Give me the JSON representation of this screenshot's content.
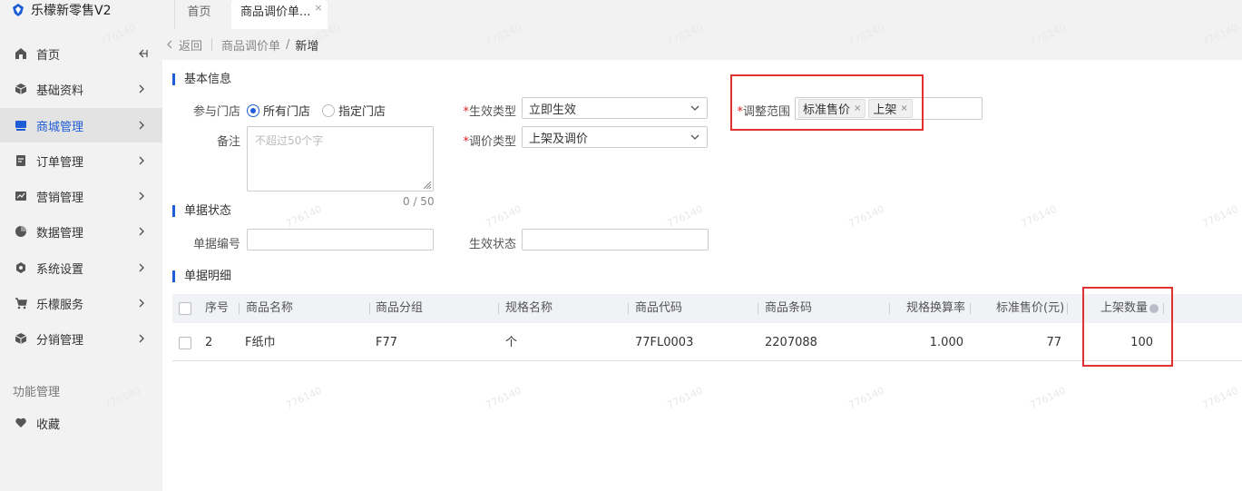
{
  "app": {
    "title": "乐檬新零售V2"
  },
  "tabs": [
    {
      "label": "首页"
    },
    {
      "label": "商品调价单...",
      "close": "×"
    }
  ],
  "sidebar": {
    "items": [
      {
        "label": "首页",
        "icon": "home-icon",
        "trailing": "collapse-icon"
      },
      {
        "label": "基础资料",
        "icon": "box-icon"
      },
      {
        "label": "商城管理",
        "icon": "monitor-icon",
        "active": true
      },
      {
        "label": "订单管理",
        "icon": "document-icon"
      },
      {
        "label": "营销管理",
        "icon": "chart-icon"
      },
      {
        "label": "数据管理",
        "icon": "pie-icon"
      },
      {
        "label": "系统设置",
        "icon": "hexagon-gear-icon"
      },
      {
        "label": "乐檬服务",
        "icon": "cart-icon"
      },
      {
        "label": "分销管理",
        "icon": "cube-icon"
      }
    ],
    "section_label": "功能管理",
    "favorite": {
      "label": "收藏",
      "icon": "heart-icon"
    }
  },
  "breadcrumb": {
    "back": "返回",
    "parent": "商品调价单",
    "separator": "/",
    "current": "新增"
  },
  "basic": {
    "title": "基本信息",
    "store_label": "参与门店",
    "store_options": [
      "所有门店",
      "指定门店"
    ],
    "store_selected": "所有门店",
    "remark_label": "备注",
    "remark_placeholder": "不超过50个字",
    "remark_counter": "0 / 50",
    "required_mark": "*",
    "effect_type_label": "生效类型",
    "effect_type_value": "立即生效",
    "adjust_type_label": "调价类型",
    "adjust_type_value": "上架及调价",
    "scope_label": "调整范围",
    "scope_tags": [
      "标准售价",
      "上架"
    ],
    "tag_close": "×"
  },
  "status": {
    "title": "单据状态",
    "number_label": "单据编号",
    "effect_status_label": "生效状态"
  },
  "detail": {
    "title": "单据明细",
    "columns": [
      "序号",
      "商品名称",
      "商品分组",
      "规格名称",
      "商品代码",
      "商品条码",
      "规格换算率",
      "标准售价(元)",
      "上架数量"
    ],
    "rows": [
      [
        "2",
        "F纸巾",
        "F77",
        "个",
        "77FL0003",
        "2207088",
        "1.000",
        "77",
        "100"
      ]
    ]
  },
  "watermark": "776140",
  "colors": {
    "accent": "#1f5dd6",
    "highlight": "#e03030",
    "required": "#e02020"
  }
}
